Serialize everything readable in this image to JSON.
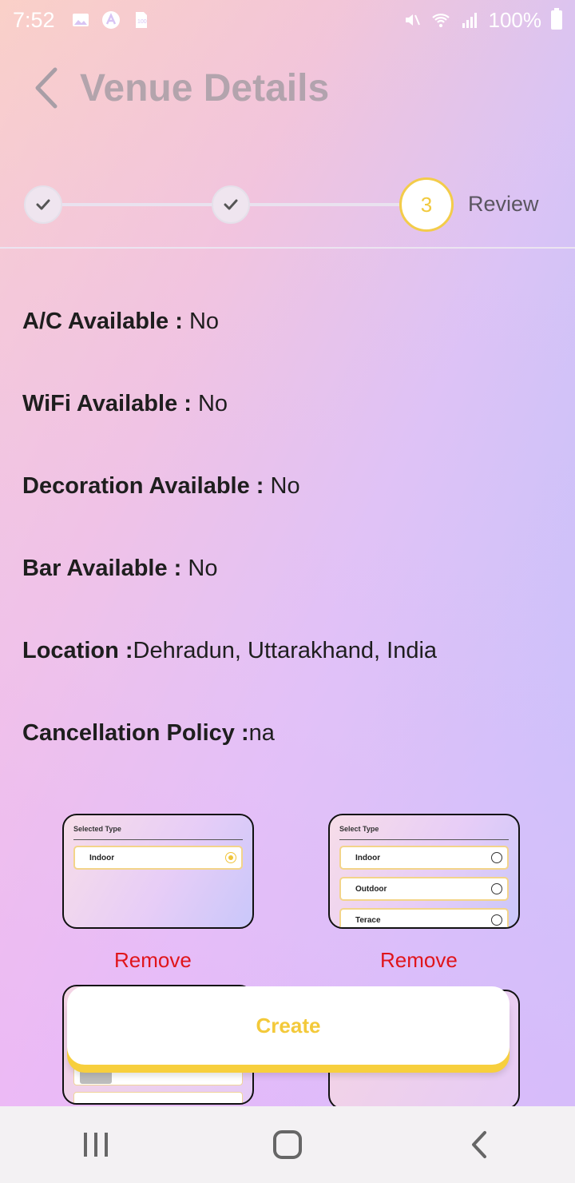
{
  "status_bar": {
    "time": "7:52",
    "battery_text": "100%"
  },
  "header": {
    "title": "Venue Details"
  },
  "stepper": {
    "current_step_number": "3",
    "current_step_label": "Review",
    "completed_steps": 2
  },
  "details": [
    {
      "key": "A/C Available : ",
      "value": " No"
    },
    {
      "key": "WiFi Available : ",
      "value": " No"
    },
    {
      "key": "Decoration Available : ",
      "value": " No"
    },
    {
      "key": "Bar Available : ",
      "value": " No"
    },
    {
      "key": "Location :",
      "value": "Dehradun, Uttarakhand, India"
    },
    {
      "key": "Cancellation Policy :",
      "value": "na"
    }
  ],
  "images": [
    {
      "title": "Selected Type",
      "options": [
        {
          "label": "Indoor",
          "selected": true
        }
      ],
      "remove_label": "Remove"
    },
    {
      "title": "Select Type",
      "options": [
        {
          "label": "Indoor",
          "selected": false
        },
        {
          "label": "Outdoor",
          "selected": false
        },
        {
          "label": "Terace",
          "selected": false
        }
      ],
      "remove_label": "Remove"
    }
  ],
  "actions": {
    "create_label": "Create"
  },
  "colors": {
    "accent_yellow": "#f3c93a",
    "remove_red": "#e0151b",
    "title_gray": "#a89ea6"
  }
}
